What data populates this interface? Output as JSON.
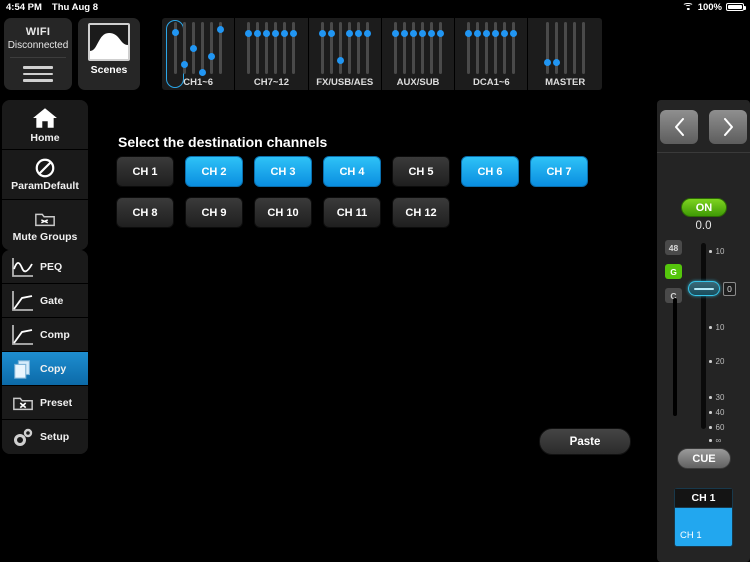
{
  "statusbar": {
    "time": "4:54 PM",
    "date": "Thu Aug 8",
    "battery_percent": "100%",
    "wifi_icon": "wifi-icon",
    "battery_icon": "battery-icon"
  },
  "topbar": {
    "wifi_box": {
      "title": "WIFI",
      "status": "Disconnected",
      "menu_icon": "hamburger-menu-icon"
    },
    "scenes_box": {
      "label": "Scenes",
      "icon": "scenes-curve-icon"
    },
    "groups": [
      {
        "label": "CH1~6",
        "selected": true,
        "strips": 6,
        "knobs": [
          14,
          75,
          44,
          90,
          60,
          8
        ]
      },
      {
        "label": "CH7~12",
        "selected": false,
        "strips": 6,
        "knobs": [
          16,
          16,
          16,
          16,
          16,
          16
        ]
      },
      {
        "label": "FX/USB/AES",
        "selected": false,
        "strips": 6,
        "knobs": [
          16,
          16,
          68,
          16,
          16,
          16
        ]
      },
      {
        "label": "AUX/SUB",
        "selected": false,
        "strips": 6,
        "knobs": [
          16,
          16,
          16,
          16,
          16,
          16
        ]
      },
      {
        "label": "DCA1~6",
        "selected": false,
        "strips": 6,
        "knobs": [
          16,
          16,
          16,
          16,
          16,
          16
        ]
      },
      {
        "label": "MASTER",
        "selected": false,
        "strips": 5,
        "knobs": [
          72,
          72,
          null,
          null,
          null
        ]
      }
    ]
  },
  "sidebar": {
    "top_items": [
      {
        "label": "Home",
        "icon": "home-icon",
        "active": false
      },
      {
        "label": "ParamDefault",
        "icon": "no-entry-icon",
        "active": false
      },
      {
        "label": "Mute Groups",
        "icon": "mute-groups-folder-icon",
        "active": false
      }
    ],
    "bottom_items": [
      {
        "label": "PEQ",
        "icon": "peq-curve-icon",
        "active": false
      },
      {
        "label": "Gate",
        "icon": "gate-curve-icon",
        "active": false
      },
      {
        "label": "Comp",
        "icon": "comp-curve-icon",
        "active": false
      },
      {
        "label": "Copy",
        "icon": "copy-pages-icon",
        "active": true
      },
      {
        "label": "Preset",
        "icon": "preset-folder-icon",
        "active": false
      },
      {
        "label": "Setup",
        "icon": "gear-icon",
        "active": false
      }
    ]
  },
  "main": {
    "title": "Select the destination channels",
    "channels": [
      {
        "label": "CH 1",
        "selected": false
      },
      {
        "label": "CH 2",
        "selected": true
      },
      {
        "label": "CH 3",
        "selected": true
      },
      {
        "label": "CH 4",
        "selected": true
      },
      {
        "label": "CH 5",
        "selected": false
      },
      {
        "label": "CH 6",
        "selected": true
      },
      {
        "label": "CH 7",
        "selected": true
      },
      {
        "label": "CH 8",
        "selected": false
      },
      {
        "label": "CH 9",
        "selected": false
      },
      {
        "label": "CH 10",
        "selected": false
      },
      {
        "label": "CH 11",
        "selected": false
      },
      {
        "label": "CH 12",
        "selected": false
      }
    ],
    "paste_label": "Paste"
  },
  "right_panel": {
    "prev_icon": "chevron-left-icon",
    "next_icon": "chevron-right-icon",
    "on_label": "ON",
    "level": "0.0",
    "badges": [
      {
        "label": "48",
        "state": "off"
      },
      {
        "label": "G",
        "state": "on"
      },
      {
        "label": "C",
        "state": "off"
      }
    ],
    "fader_value": "0",
    "scale_ticks": [
      "10",
      "0",
      "10",
      "20",
      "30",
      "40",
      "60",
      "∞"
    ],
    "cue_label": "CUE",
    "channel_card": {
      "number": "CH 1",
      "name": "CH 1"
    }
  },
  "colors": {
    "accent_blue": "#22a7ef",
    "on_green": "#55c60c",
    "fader_cyan": "#36c6ea",
    "panel_bg": "#242424"
  }
}
